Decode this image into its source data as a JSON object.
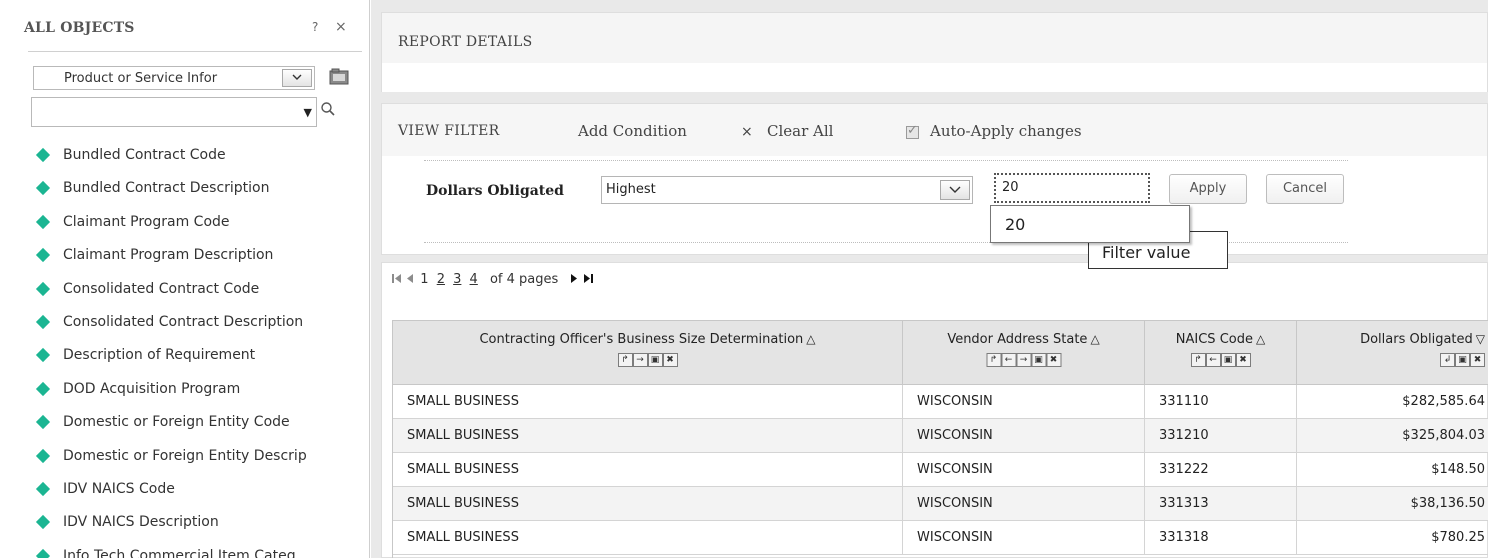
{
  "left_panel": {
    "title": "ALL OBJECTS",
    "help": "?",
    "close": "×",
    "subject_select": {
      "value": "Product or Service Infor"
    },
    "search_input": {
      "value": "",
      "placeholder": ""
    },
    "items": [
      "Bundled Contract Code",
      "Bundled Contract Description",
      "Claimant Program Code",
      "Claimant Program Description",
      "Consolidated Contract Code",
      "Consolidated Contract Description",
      "Description of Requirement",
      "DOD Acquisition Program",
      "Domestic or Foreign Entity Code",
      "Domestic or Foreign Entity Descrip",
      "IDV NAICS Code",
      "IDV NAICS Description",
      "Info Tech Commercial Item Categ"
    ],
    "item_icon_color": "#1bb592"
  },
  "report_details": {
    "title": "REPORT DETAILS"
  },
  "view_filter": {
    "title": "VIEW FILTER",
    "add_condition": "Add Condition",
    "clear_icon": "×",
    "clear_all": "Clear All",
    "auto_apply": "Auto-Apply changes",
    "auto_apply_checked": true,
    "condition": {
      "label": "Dollars Obligated",
      "operator": "Highest",
      "value": "20",
      "apply": "Apply",
      "cancel": "Cancel"
    },
    "suggestion": "20",
    "tooltip": "Filter value"
  },
  "pager": {
    "first": "⏮",
    "prev": "◀",
    "current": "1",
    "pages": [
      "2",
      "3",
      "4"
    ],
    "summary": "of 4 pages",
    "next": "▶",
    "last": "⏭"
  },
  "table": {
    "columns": [
      {
        "label": "Contracting Officer's Business Size Determination",
        "sort": "△",
        "controls": [
          "↱",
          "→",
          "▣",
          "✖"
        ]
      },
      {
        "label": "Vendor Address State",
        "sort": "△",
        "controls": [
          "↱",
          "←",
          "→",
          "▣",
          "✖"
        ]
      },
      {
        "label": "NAICS Code",
        "sort": "△",
        "controls": [
          "↱",
          "←",
          "▣",
          "✖"
        ]
      },
      {
        "label": "Dollars Obligated",
        "sort": "▽",
        "controls": [
          "↲",
          "▣",
          "✖"
        ]
      }
    ],
    "rows": [
      [
        "SMALL BUSINESS",
        "WISCONSIN",
        "331110",
        "$282,585.64"
      ],
      [
        "SMALL BUSINESS",
        "WISCONSIN",
        "331210",
        "$325,804.03"
      ],
      [
        "SMALL BUSINESS",
        "WISCONSIN",
        "331222",
        "$148.50"
      ],
      [
        "SMALL BUSINESS",
        "WISCONSIN",
        "331313",
        "$38,136.50"
      ],
      [
        "SMALL BUSINESS",
        "WISCONSIN",
        "331318",
        "$780.25"
      ]
    ]
  }
}
